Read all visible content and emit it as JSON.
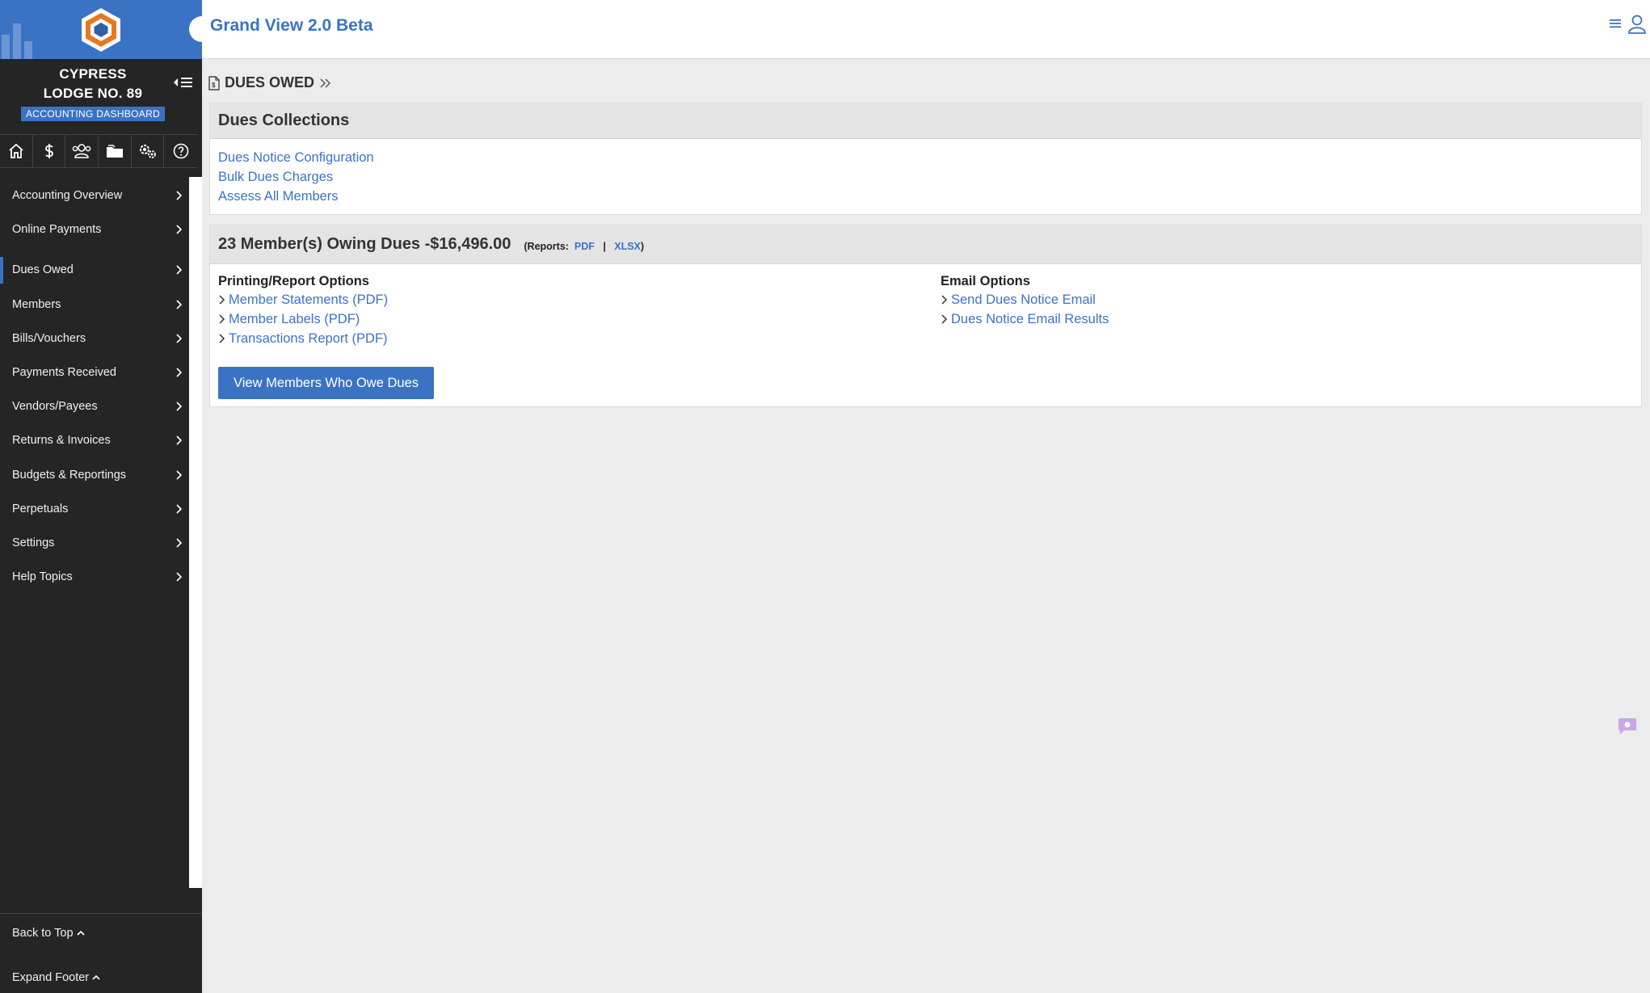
{
  "app": {
    "title": "Grand View 2.0 Beta"
  },
  "sidebar": {
    "lodge_line1": "CYPRESS",
    "lodge_line2": "LODGE NO. 89",
    "badge": "ACCOUNTING DASHBOARD",
    "icon_bar": [
      "home-icon",
      "dollar-icon",
      "users-icon",
      "folder-icon",
      "gears-icon",
      "help-icon"
    ],
    "items": [
      {
        "label": "Accounting Overview"
      },
      {
        "label": "Online Payments"
      },
      {
        "label": "Dues Owed",
        "active": true
      },
      {
        "label": "Members"
      },
      {
        "label": "Bills/Vouchers"
      },
      {
        "label": "Payments Received"
      },
      {
        "label": "Vendors/Payees"
      },
      {
        "label": "Returns & Invoices"
      },
      {
        "label": "Budgets & Reportings"
      },
      {
        "label": "Perpetuals"
      },
      {
        "label": "Settings"
      },
      {
        "label": "Help Topics"
      }
    ],
    "footer": {
      "back_to_top": "Back to Top",
      "expand_footer": "Expand Footer"
    }
  },
  "breadcrumb": {
    "label": "DUES OWED"
  },
  "collections": {
    "title": "Dues Collections",
    "links": [
      "Dues Notice Configuration",
      "Bulk Dues Charges",
      "Assess All Members"
    ]
  },
  "owing": {
    "title": "23 Member(s) Owing Dues -$16,496.00",
    "reports_prefix": "(Reports:",
    "pdf": "PDF",
    "sep": "|",
    "xlsx": "XLSX",
    "reports_suffix": ")",
    "printing": {
      "title": "Printing/Report Options",
      "options": [
        "Member Statements (PDF)",
        "Member Labels (PDF)",
        "Transactions Report (PDF)"
      ]
    },
    "email": {
      "title": "Email Options",
      "options": [
        "Send Dues Notice Email",
        "Dues Notice Email Results"
      ]
    },
    "button": "View Members Who Owe Dues"
  },
  "colors": {
    "accent": "#3b73c4",
    "sidebar_bg": "#252525",
    "header_bg": "#e4e4e4",
    "content_bg": "#ececec"
  }
}
